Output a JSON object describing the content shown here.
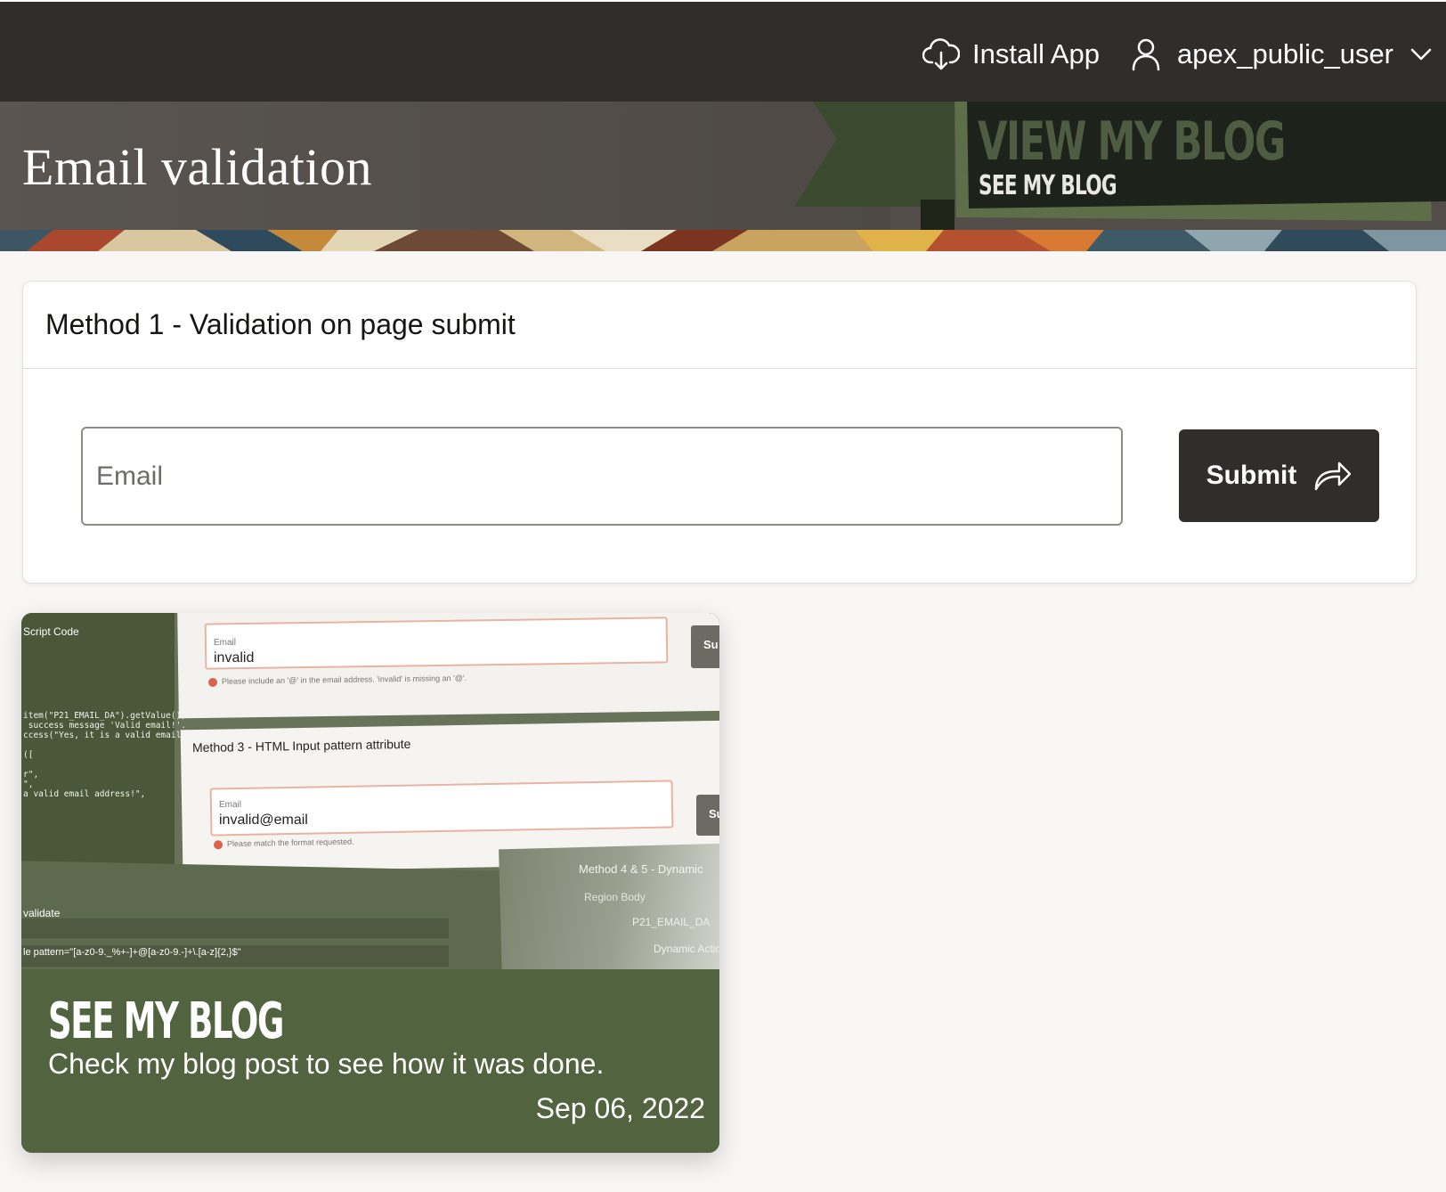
{
  "topbar": {
    "install_label": "Install App",
    "user_label": "apex_public_user"
  },
  "hero": {
    "page_title": "Email validation",
    "banner_title": "VIEW MY BLOG",
    "banner_subtitle": "SEE MY BLOG"
  },
  "region": {
    "title": "Method 1 - Validation on page submit",
    "email_label": "Email",
    "email_value": "",
    "submit_label": "Submit"
  },
  "blog_card": {
    "heading": "SEE MY BLOG",
    "description": "Check my blog post to see how it was done.",
    "date": "Sep 06, 2022",
    "image": {
      "script_code_label": "Script Code",
      "code_lines": "item(\"P21_EMAIL_DA\").getValue())\n success message 'Valid email!'.\nccess(\"Yes, it is a valid email!\"\n\n([\n\nr\",\n\",\na valid email address!\",",
      "field1_label": "Email",
      "field1_value": "invalid",
      "field1_error": "Please include an '@' in the email address. 'invalid' is missing an '@'.",
      "btn_partial_1": "Su",
      "method3_title": "Method 3 - HTML Input pattern attribute",
      "field2_label": "Email",
      "field2_value": "invalid@email",
      "field2_error": "Please match the format requested.",
      "btn_partial_2": "Su",
      "validate_label": "validate",
      "pattern_text": "le pattern=\"[a-z0-9._%+-]+@[a-z0-9.-]+\\.[a-z]{2,}$\"",
      "tree_method": "Method 4 & 5 - Dynamic",
      "tree_region_body": "Region Body",
      "tree_item": "P21_EMAIL_DA",
      "tree_dynamic": "Dynamic Action"
    }
  },
  "colors": {
    "topbar_bg": "#312d2a",
    "hero_bg": "#524d48",
    "banner_green": "#3a4a2e",
    "card_green": "#52633f",
    "button_dark": "#312d2a"
  },
  "icons": {
    "install": "cloud-download-icon",
    "user": "user-icon",
    "dropdown": "chevron-down-icon",
    "submit": "share-arrow-icon"
  }
}
